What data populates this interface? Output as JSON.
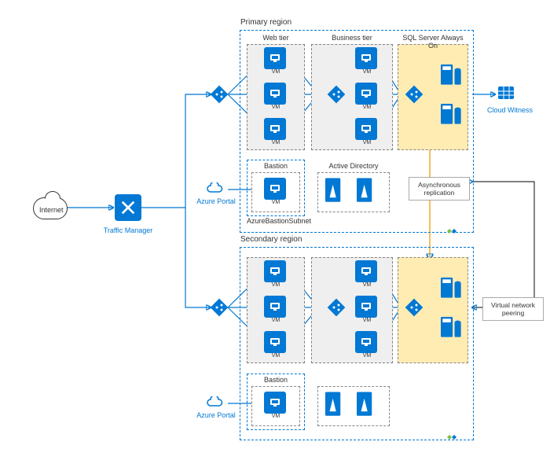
{
  "colors": {
    "azure_blue": "#0078d4",
    "orange": "#f5a623",
    "tier_bg": "#efefef",
    "sql_bg": "#ffecb3"
  },
  "internet": {
    "label": "Internet"
  },
  "traffic_manager": {
    "label": "Traffic Manager"
  },
  "azure_portal": {
    "label": "Azure Portal"
  },
  "cloud_witness": {
    "label": "Cloud Witness"
  },
  "peering_label": "Virtual network\npeering",
  "async_label": "Asynchronous\nreplication",
  "primary": {
    "title": "Primary region",
    "web": {
      "title": "Web tier",
      "vms": [
        "VM",
        "VM",
        "VM"
      ]
    },
    "biz": {
      "title": "Business tier",
      "vms": [
        "VM",
        "VM",
        "VM"
      ]
    },
    "sql": {
      "title": "SQL Server Always On"
    },
    "bastion": {
      "title": "Bastion",
      "vm": "VM",
      "subnet": "AzureBastionSubnet"
    },
    "ad": {
      "title": "Active Directory"
    }
  },
  "secondary": {
    "title": "Secondary region",
    "web_vms": [
      "VM",
      "VM",
      "VM"
    ],
    "biz_vms": [
      "VM",
      "VM",
      "VM"
    ],
    "bastion": {
      "title": "Bastion",
      "vm": "VM"
    }
  }
}
